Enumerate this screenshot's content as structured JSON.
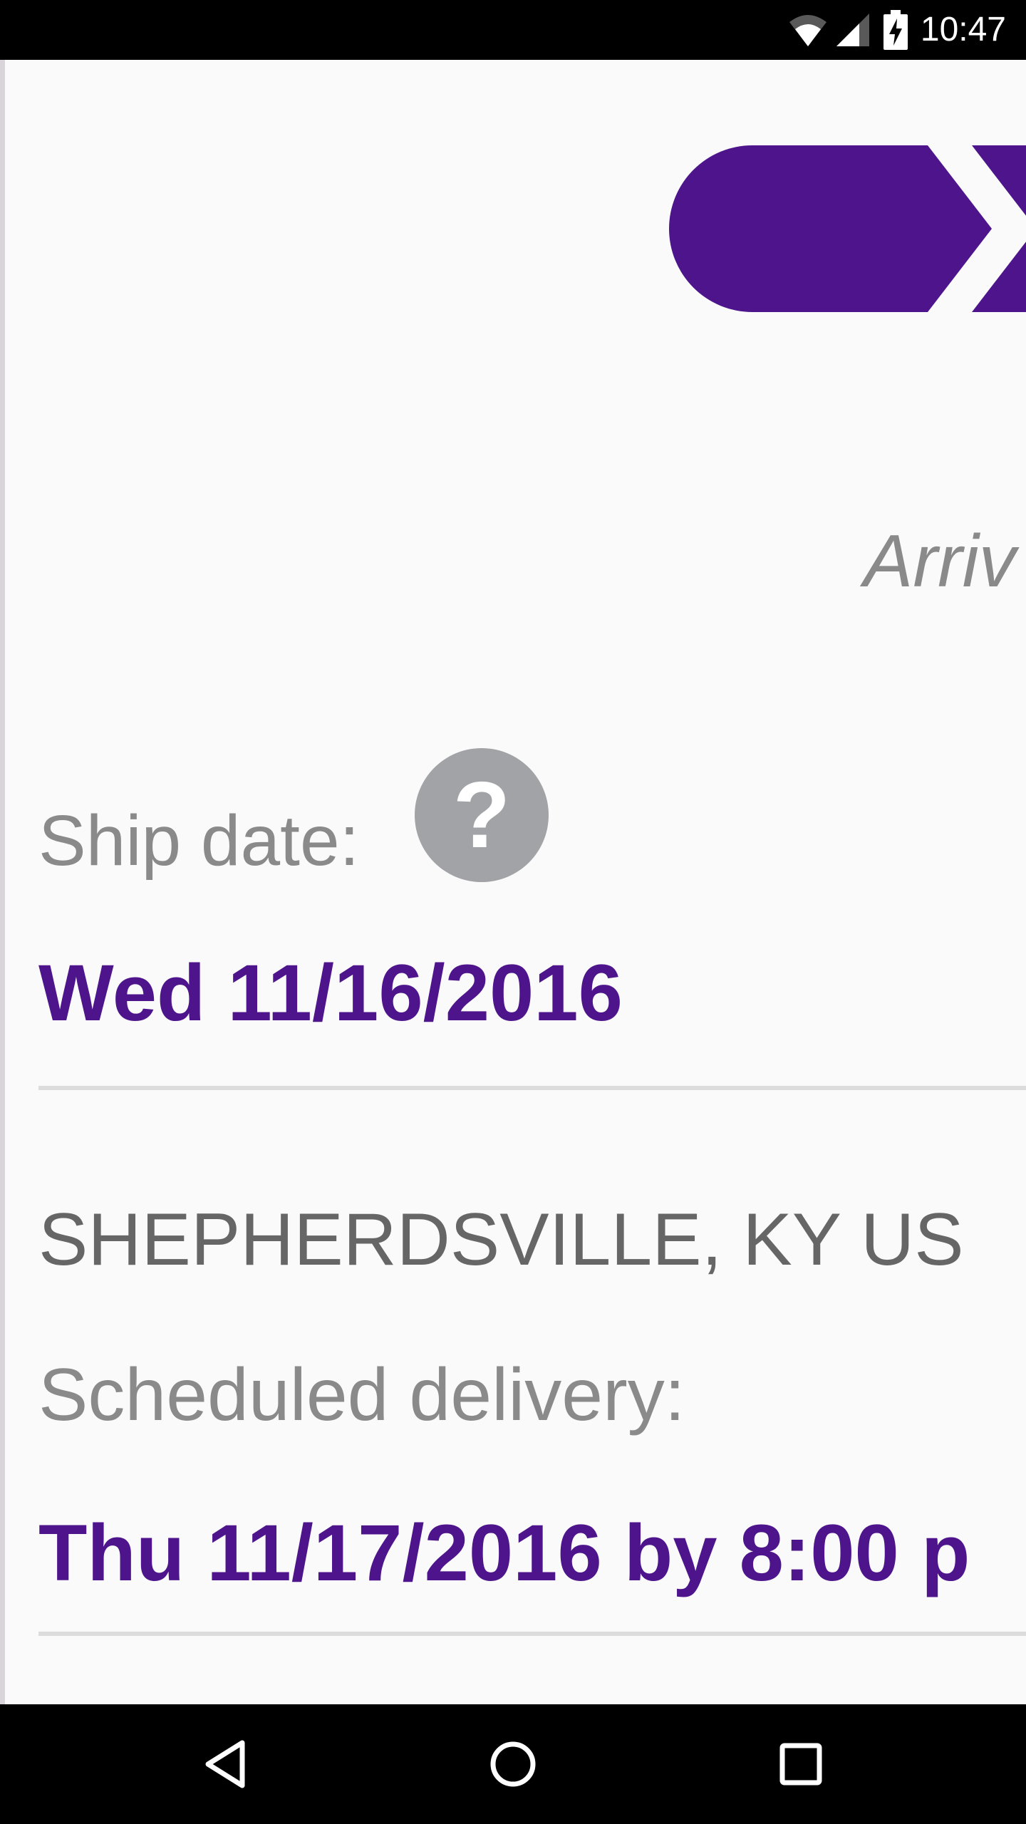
{
  "status_bar": {
    "time": "10:47",
    "icons": [
      "wifi-icon",
      "cell-signal-icon",
      "battery-charging-icon"
    ]
  },
  "shipment": {
    "arrival_text_partial": "Arriv",
    "ship_date_label": "Ship date:",
    "ship_date_value": "Wed 11/16/2016",
    "origin_location": "SHEPHERDSVILLE, KY US",
    "scheduled_delivery_label": "Scheduled delivery:",
    "scheduled_delivery_value": "Thu 11/17/2016 by 8:00 p"
  },
  "icons": {
    "help": "?",
    "progress_graphic": "shipment-progress-arrow-icon"
  },
  "nav_bar": {
    "buttons": [
      "back-icon",
      "home-icon",
      "recents-icon"
    ]
  },
  "colors": {
    "brand_purple": "#4d148c",
    "label_gray": "#8a8a8a",
    "text_gray": "#666666",
    "help_icon_gray": "#a2a3a6",
    "divider_gray": "#dcdcdc",
    "background": "#fafafa"
  }
}
